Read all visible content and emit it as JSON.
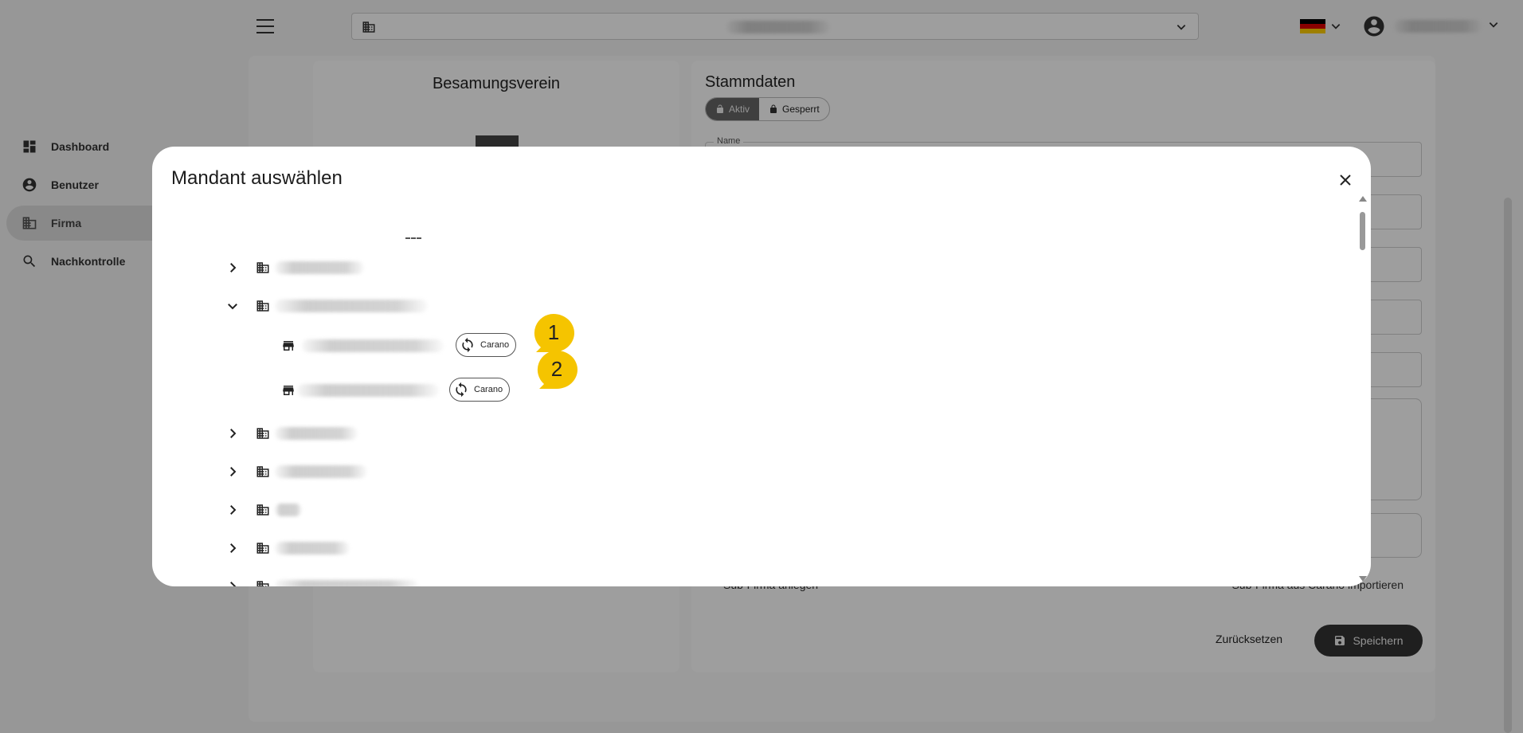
{
  "app": {
    "nav": [
      {
        "label": "Dashboard",
        "icon": "dashboard-icon"
      },
      {
        "label": "Benutzer",
        "icon": "account-circle-icon"
      },
      {
        "label": "Firma",
        "icon": "building-icon",
        "active": true
      },
      {
        "label": "Nachkontrolle",
        "icon": "search-icon"
      }
    ],
    "left_panel_title": "Besamungsverein",
    "right_panel": {
      "title": "Stammdaten",
      "status_active": "Aktiv",
      "status_locked": "Gesperrt",
      "name_label": "Name",
      "link_sub_create": "Sub-Firma anlegen",
      "link_sub_import": "Sub-Firma aus Carano importieren",
      "reset_label": "Zurücksetzen",
      "save_label": "Speichern"
    },
    "flag_colors": [
      "#000000",
      "#dd0000",
      "#ffce00"
    ]
  },
  "dialog": {
    "title": "Mandant auswählen",
    "chip_label": "Carano",
    "callouts": [
      "1",
      "2"
    ],
    "callout_color": "#f5c400"
  }
}
